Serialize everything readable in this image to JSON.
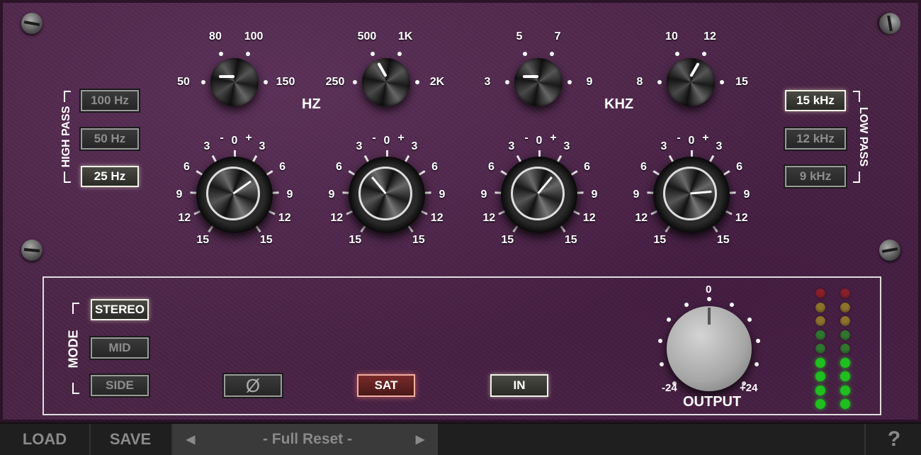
{
  "eq": {
    "hz_label": "HZ",
    "khz_label": "KHZ",
    "freq_knobs": [
      {
        "name": "low-freq",
        "labels": [
          "50",
          "80",
          "100",
          "150"
        ]
      },
      {
        "name": "lowmid-freq",
        "labels": [
          "250",
          "500",
          "1K",
          "2K"
        ]
      },
      {
        "name": "highmid-freq",
        "labels": [
          "3",
          "5",
          "7",
          "9"
        ]
      },
      {
        "name": "high-freq",
        "labels": [
          "8",
          "10",
          "12",
          "15"
        ]
      }
    ],
    "gain_scale": {
      "minus": "-",
      "zero": "0",
      "plus": "+",
      "l3": "3",
      "r3": "3",
      "l6": "6",
      "r6": "6",
      "l9": "9",
      "r9": "9",
      "l12": "12",
      "r12": "12",
      "l15": "15",
      "r15": "15"
    }
  },
  "high_pass": {
    "label": "HIGH PASS",
    "buttons": [
      "100 Hz",
      "50 Hz",
      "25 Hz"
    ],
    "selected": "25 Hz"
  },
  "low_pass": {
    "label": "LOW PASS",
    "buttons": [
      "15 kHz",
      "12 kHz",
      "9 kHz"
    ],
    "selected": "15 kHz"
  },
  "mode": {
    "label": "MODE",
    "buttons": [
      "STEREO",
      "MID",
      "SIDE"
    ],
    "selected": "STEREO"
  },
  "controls": {
    "phase_symbol": "Ø",
    "sat_label": "SAT",
    "in_label": "IN"
  },
  "output": {
    "label": "OUTPUT",
    "min": "-24",
    "max": "+24",
    "center": "0",
    "value_db": 0
  },
  "bottom_bar": {
    "load": "LOAD",
    "save": "SAVE",
    "prev": "◀",
    "next": "▶",
    "preset": "- Full Reset -",
    "help": "?"
  },
  "colors": {
    "panel": "#4a2446",
    "led_red": "#c0201a",
    "led_yellow": "#c9b81a",
    "led_green": "#1fbf1f",
    "sat_active": "#7a2a2a"
  }
}
